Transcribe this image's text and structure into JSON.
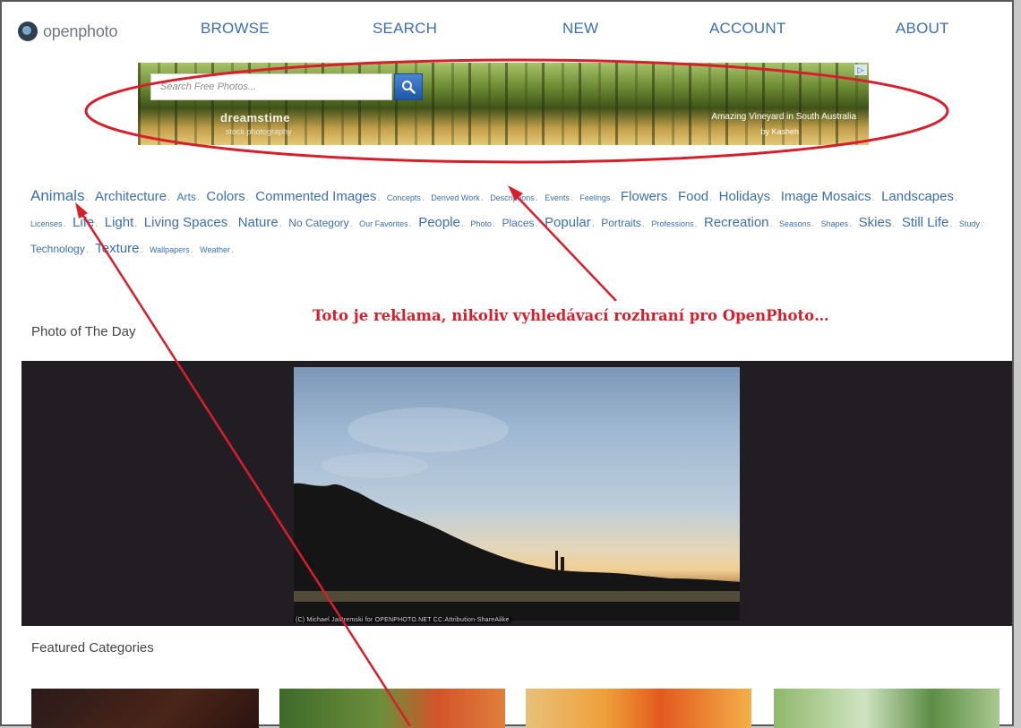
{
  "header": {
    "logo_text": "openphoto",
    "nav": [
      "BROWSE",
      "SEARCH",
      "NEW",
      "ACCOUNT",
      "ABOUT"
    ]
  },
  "ad": {
    "search_placeholder": "Search Free Photos...",
    "brand": "dreamstime",
    "brand_sub": "stock photography",
    "caption": "Amazing Vineyard in South Australia",
    "caption_by": "by Kasheh",
    "choice_icon": "ad-choices-icon"
  },
  "categories": [
    {
      "label": "Animals",
      "size": 4
    },
    {
      "label": "Architecture",
      "size": 3
    },
    {
      "label": "Arts",
      "size": 2
    },
    {
      "label": "Colors",
      "size": 3
    },
    {
      "label": "Commented Images",
      "size": 3
    },
    {
      "label": "Concepts",
      "size": 1
    },
    {
      "label": "Derived Work",
      "size": 1
    },
    {
      "label": "Descriptions",
      "size": 1
    },
    {
      "label": "Events",
      "size": 1
    },
    {
      "label": "Feelings",
      "size": 1
    },
    {
      "label": "Flowers",
      "size": 3
    },
    {
      "label": "Food",
      "size": 3
    },
    {
      "label": "Holidays",
      "size": 3
    },
    {
      "label": "Image Mosaics",
      "size": 3
    },
    {
      "label": "Landscapes",
      "size": 3
    },
    {
      "label": "Licenses",
      "size": 1
    },
    {
      "label": "Life",
      "size": 3
    },
    {
      "label": "Light",
      "size": 3
    },
    {
      "label": "Living Spaces",
      "size": 3
    },
    {
      "label": "Nature",
      "size": 3
    },
    {
      "label": "No Category",
      "size": 2
    },
    {
      "label": "Our Favorites",
      "size": 1
    },
    {
      "label": "People",
      "size": 3
    },
    {
      "label": "Photo",
      "size": 1
    },
    {
      "label": "Places",
      "size": 2
    },
    {
      "label": "Popular",
      "size": 3
    },
    {
      "label": "Portraits",
      "size": 2
    },
    {
      "label": "Professions",
      "size": 1
    },
    {
      "label": "Recreation",
      "size": 3
    },
    {
      "label": "Seasons",
      "size": 1
    },
    {
      "label": "Shapes",
      "size": 1
    },
    {
      "label": "Skies",
      "size": 3
    },
    {
      "label": "Still Life",
      "size": 3
    },
    {
      "label": "Study",
      "size": 1
    },
    {
      "label": "Technology",
      "size": 2
    },
    {
      "label": "Texture",
      "size": 3
    },
    {
      "label": "Wallpapers",
      "size": 1
    },
    {
      "label": "Weather",
      "size": 1
    }
  ],
  "photo_of_day": {
    "title": "Photo of The Day",
    "credit": "(C) Michael Jastremski for OPENPHOTO.NET CC:Attribution-ShareAlike"
  },
  "featured": {
    "title": "Featured Categories"
  },
  "annotation": {
    "text": "Toto je reklama, nikoliv vyhledávací rozhraní pro OpenPhoto…",
    "color": "#d71f2b"
  }
}
